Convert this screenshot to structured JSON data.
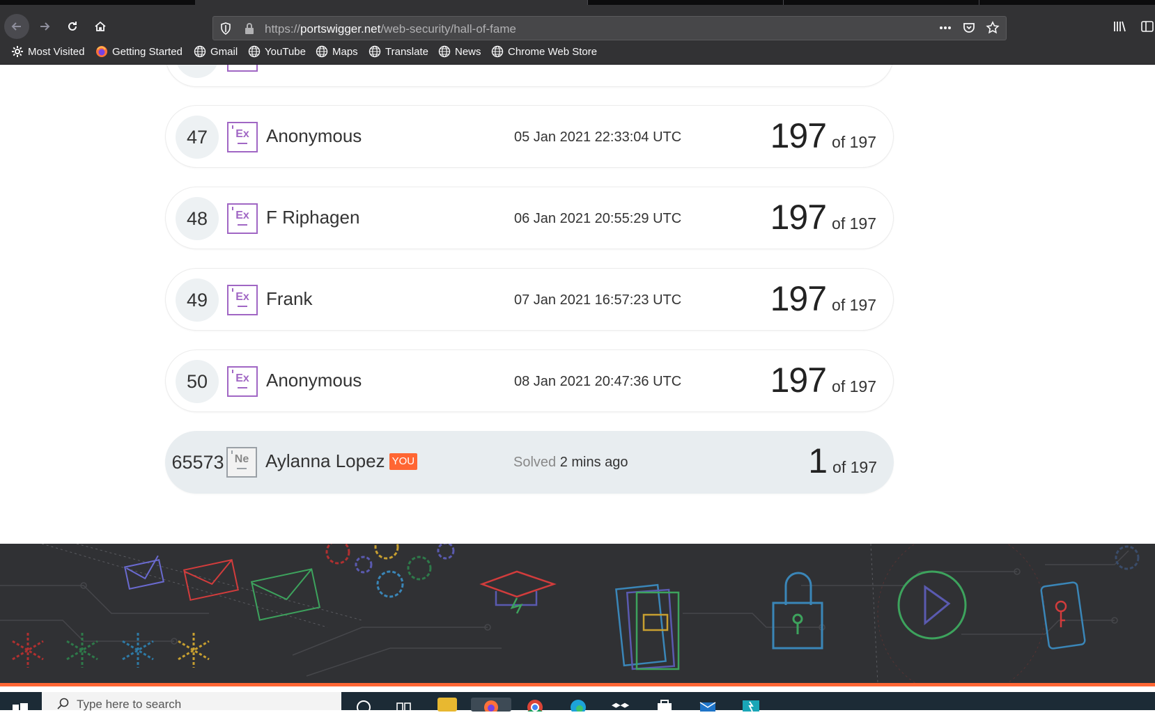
{
  "browser": {
    "url_scheme": "https://",
    "url_host": "portswigger.net",
    "url_path": "/web-security/hall-of-fame",
    "bookmarks": [
      {
        "label": "Most Visited",
        "icon": "gear-icon"
      },
      {
        "label": "Getting Started",
        "icon": "firefox-icon"
      },
      {
        "label": "Gmail",
        "icon": "globe-icon"
      },
      {
        "label": "YouTube",
        "icon": "globe-icon"
      },
      {
        "label": "Maps",
        "icon": "globe-icon"
      },
      {
        "label": "Translate",
        "icon": "globe-icon"
      },
      {
        "label": "News",
        "icon": "globe-icon"
      },
      {
        "label": "Chrome Web Store",
        "icon": "globe-icon"
      }
    ]
  },
  "leaderboard": {
    "rows": [
      {
        "rank": "47",
        "badge": "Ex",
        "name": "Anonymous",
        "date": "05 Jan 2021 22:33:04 UTC",
        "score": "197",
        "total": "of 197"
      },
      {
        "rank": "48",
        "badge": "Ex",
        "name": "F Riphagen",
        "date": "06 Jan 2021 20:55:29 UTC",
        "score": "197",
        "total": "of 197"
      },
      {
        "rank": "49",
        "badge": "Ex",
        "name": "Frank",
        "date": "07 Jan 2021 16:57:23 UTC",
        "score": "197",
        "total": "of 197"
      },
      {
        "rank": "50",
        "badge": "Ex",
        "name": "Anonymous",
        "date": "08 Jan 2021 20:47:36 UTC",
        "score": "197",
        "total": "of 197"
      }
    ],
    "you_row": {
      "rank": "65573",
      "badge": "Ne",
      "name": "Aylanna Lopez",
      "tag": "YOU",
      "solved_label": "Solved",
      "solved_time": "2 mins ago",
      "score": "1",
      "total": "of 197"
    }
  },
  "taskbar": {
    "search_placeholder": "Type here to search"
  },
  "colors": {
    "accent": "#ff6633",
    "expert_badge": "#a066c4",
    "footer_bg": "#303134"
  }
}
